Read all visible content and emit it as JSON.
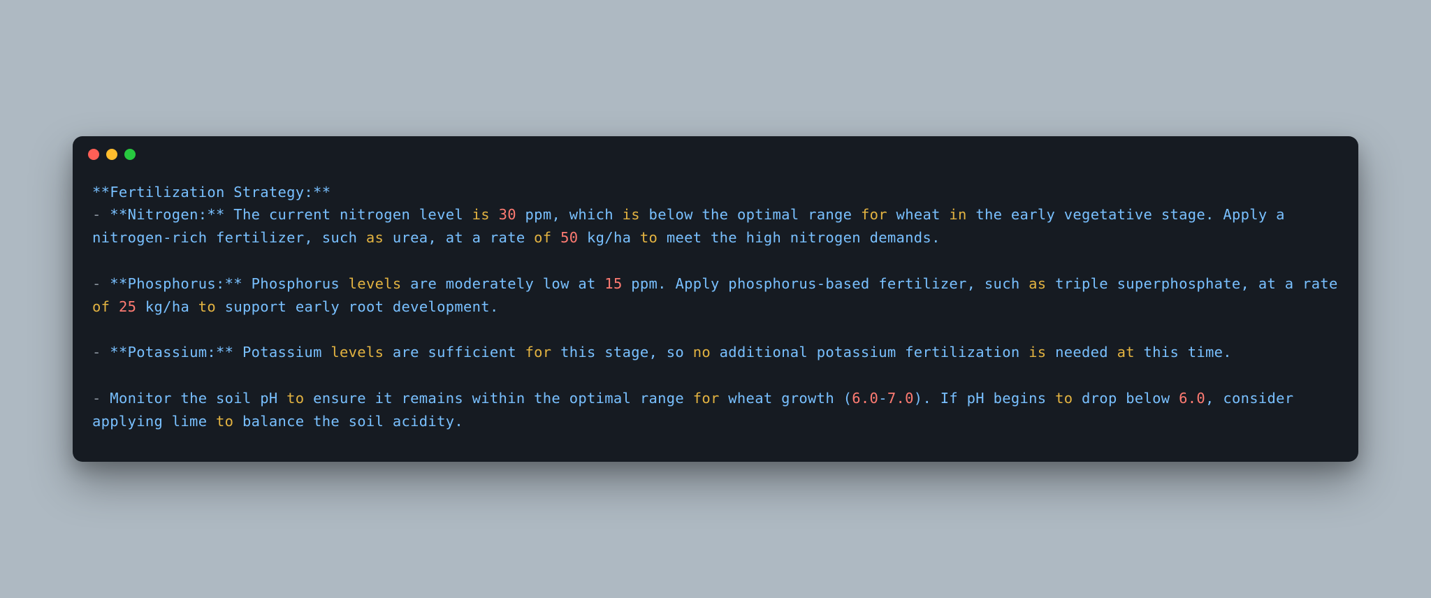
{
  "colors": {
    "background": "#aeb9c2",
    "window": "#161b22",
    "blue": "#79c0ff",
    "yellow": "#e3b341",
    "red": "#ff7b72",
    "gray": "#8b949e",
    "trafficRed": "#ff5f56",
    "trafficYellow": "#ffbd2e",
    "trafficGreen": "#27c93f"
  },
  "content": {
    "tokens": [
      {
        "t": "**Fertilization Strategy:**",
        "c": "blue"
      },
      {
        "t": "\n",
        "c": "gray"
      },
      {
        "t": "- ",
        "c": "gray"
      },
      {
        "t": "**Nitrogen:**",
        "c": "blue"
      },
      {
        "t": " The current nitrogen level ",
        "c": "blue"
      },
      {
        "t": "is",
        "c": "yellow"
      },
      {
        "t": " ",
        "c": "blue"
      },
      {
        "t": "30",
        "c": "red"
      },
      {
        "t": " ppm, which ",
        "c": "blue"
      },
      {
        "t": "is",
        "c": "yellow"
      },
      {
        "t": " below the optimal range ",
        "c": "blue"
      },
      {
        "t": "for",
        "c": "yellow"
      },
      {
        "t": " wheat ",
        "c": "blue"
      },
      {
        "t": "in",
        "c": "yellow"
      },
      {
        "t": " the early vegetative stage. Apply a nitrogen-rich fertilizer, such ",
        "c": "blue"
      },
      {
        "t": "as",
        "c": "yellow"
      },
      {
        "t": " urea, at a rate ",
        "c": "blue"
      },
      {
        "t": "of",
        "c": "yellow"
      },
      {
        "t": " ",
        "c": "blue"
      },
      {
        "t": "50",
        "c": "red"
      },
      {
        "t": " kg/ha ",
        "c": "blue"
      },
      {
        "t": "to",
        "c": "yellow"
      },
      {
        "t": " meet the high nitrogen demands.",
        "c": "blue"
      },
      {
        "t": "\n\n",
        "c": "gray"
      },
      {
        "t": "- ",
        "c": "gray"
      },
      {
        "t": "**Phosphorus:**",
        "c": "blue"
      },
      {
        "t": " Phosphorus ",
        "c": "blue"
      },
      {
        "t": "levels",
        "c": "yellow"
      },
      {
        "t": " are moderately low at ",
        "c": "blue"
      },
      {
        "t": "15",
        "c": "red"
      },
      {
        "t": " ppm. Apply phosphorus-based fertilizer, such ",
        "c": "blue"
      },
      {
        "t": "as",
        "c": "yellow"
      },
      {
        "t": " triple superphosphate, at a rate ",
        "c": "blue"
      },
      {
        "t": "of",
        "c": "yellow"
      },
      {
        "t": " ",
        "c": "blue"
      },
      {
        "t": "25",
        "c": "red"
      },
      {
        "t": " kg/ha ",
        "c": "blue"
      },
      {
        "t": "to",
        "c": "yellow"
      },
      {
        "t": " support early root development.",
        "c": "blue"
      },
      {
        "t": "\n\n",
        "c": "gray"
      },
      {
        "t": "- ",
        "c": "gray"
      },
      {
        "t": "**Potassium:**",
        "c": "blue"
      },
      {
        "t": " Potassium ",
        "c": "blue"
      },
      {
        "t": "levels",
        "c": "yellow"
      },
      {
        "t": " are sufficient ",
        "c": "blue"
      },
      {
        "t": "for",
        "c": "yellow"
      },
      {
        "t": " this stage, so ",
        "c": "blue"
      },
      {
        "t": "no",
        "c": "yellow"
      },
      {
        "t": " additional potassium fertilization ",
        "c": "blue"
      },
      {
        "t": "is",
        "c": "yellow"
      },
      {
        "t": " needed ",
        "c": "blue"
      },
      {
        "t": "at",
        "c": "yellow"
      },
      {
        "t": " this time.",
        "c": "blue"
      },
      {
        "t": "\n\n",
        "c": "gray"
      },
      {
        "t": "- ",
        "c": "gray"
      },
      {
        "t": "Monitor the soil pH ",
        "c": "blue"
      },
      {
        "t": "to",
        "c": "yellow"
      },
      {
        "t": " ensure it remains within the optimal range ",
        "c": "blue"
      },
      {
        "t": "for",
        "c": "yellow"
      },
      {
        "t": " wheat growth (",
        "c": "blue"
      },
      {
        "t": "6.0",
        "c": "red"
      },
      {
        "t": "-",
        "c": "blue"
      },
      {
        "t": "7.0",
        "c": "red"
      },
      {
        "t": "). If pH begins ",
        "c": "blue"
      },
      {
        "t": "to",
        "c": "yellow"
      },
      {
        "t": " drop below ",
        "c": "blue"
      },
      {
        "t": "6.0",
        "c": "red"
      },
      {
        "t": ", consider applying lime ",
        "c": "blue"
      },
      {
        "t": "to",
        "c": "yellow"
      },
      {
        "t": " balance the soil acidity.",
        "c": "blue"
      }
    ]
  }
}
